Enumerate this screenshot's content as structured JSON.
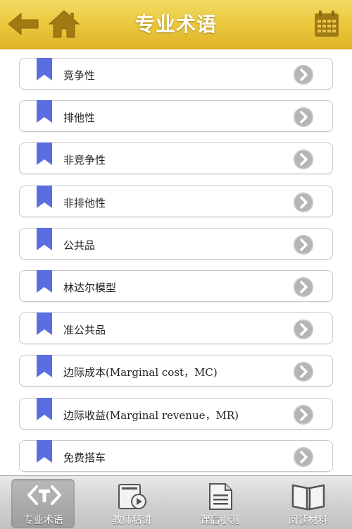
{
  "header": {
    "title": "专业术语",
    "back_icon": "back-arrow-icon",
    "home_icon": "home-icon",
    "calendar_icon": "calendar-icon"
  },
  "colors": {
    "header_gold": "#e9c53a",
    "bookmark_blue": "#5b6ee1",
    "chevron_gray": "#b5b5b5"
  },
  "terms": [
    {
      "label": "竞争性"
    },
    {
      "label": "排他性"
    },
    {
      "label": "非竞争性"
    },
    {
      "label": "非排他性"
    },
    {
      "label": "公共品"
    },
    {
      "label": "林达尔模型"
    },
    {
      "label": "准公共品"
    },
    {
      "label": "边际成本(Marginal cost，MC)"
    },
    {
      "label": "边际收益(Marginal revenue，MR)"
    },
    {
      "label": "免费搭车"
    }
  ],
  "tabs": [
    {
      "label": "专业术语",
      "icon": "terms-icon",
      "active": true
    },
    {
      "label": "教师精讲",
      "icon": "video-lecture-icon",
      "active": false
    },
    {
      "label": "课后小测",
      "icon": "document-quiz-icon",
      "active": false
    },
    {
      "label": "阅读材料",
      "icon": "open-book-icon",
      "active": false
    }
  ]
}
